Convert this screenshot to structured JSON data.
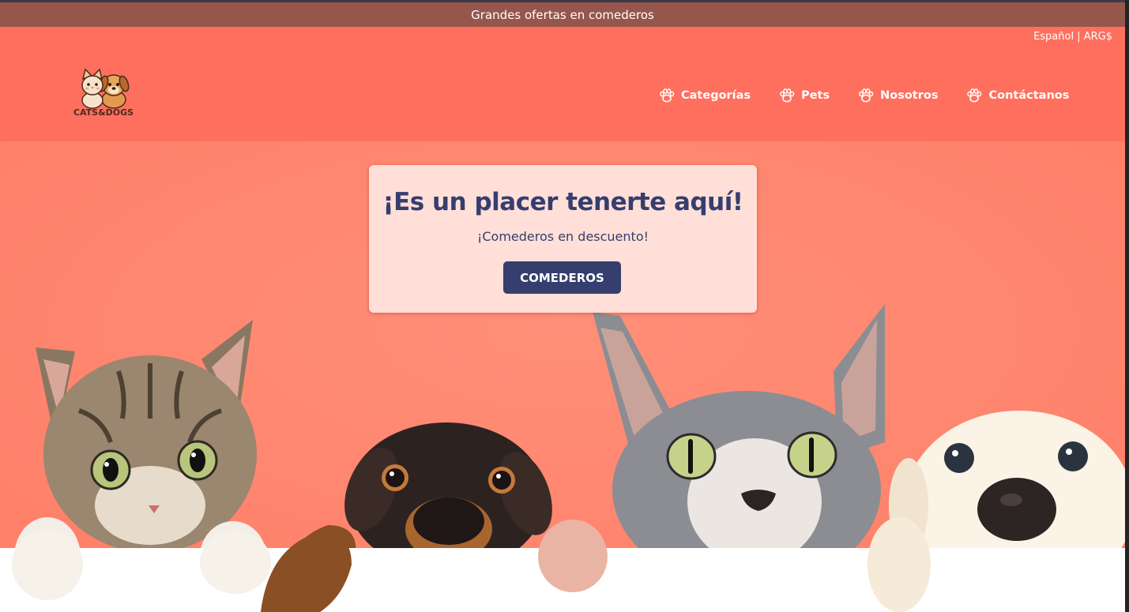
{
  "promo": {
    "text": "Grandes ofertas en comederos"
  },
  "header": {
    "locale": "Español | ARG$",
    "logo_text": "CATS&DOGS",
    "nav": [
      {
        "label": "Categorías",
        "icon": "paw-icon"
      },
      {
        "label": "Pets",
        "icon": "paw-icon"
      },
      {
        "label": "Nosotros",
        "icon": "paw-icon"
      },
      {
        "label": "Contáctanos",
        "icon": "paw-icon"
      }
    ]
  },
  "hero": {
    "title": "¡Es un placer tenerte aquí!",
    "subtitle": "¡Comederos en descuento!",
    "button_label": "COMEDEROS"
  },
  "colors": {
    "promo_bar": "#96564c",
    "header": "#ff6f5e",
    "hero_background": "#ff8a73",
    "card": "#ffdfd8",
    "accent_navy": "#353e6e"
  }
}
